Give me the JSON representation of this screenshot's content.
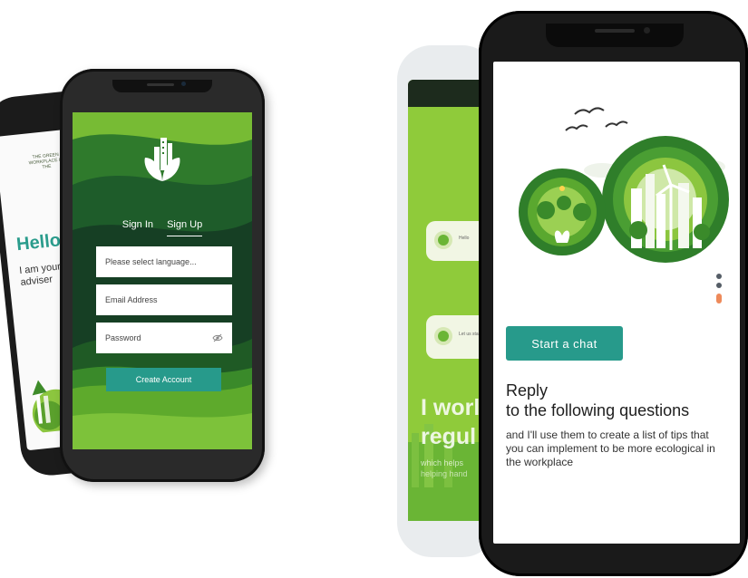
{
  "back_left": {
    "tiny_text": "THE GREEN WORKPLACE IN THE",
    "greeting": "Hello,",
    "intro_line1": "I am your N",
    "intro_line2": "adviser"
  },
  "signup_screen": {
    "tabs": [
      {
        "label": "Sign In",
        "active": false
      },
      {
        "label": "Sign Up",
        "active": true
      }
    ],
    "language_placeholder": "Please select language...",
    "email_placeholder": "Email Address",
    "password_placeholder": "Password",
    "create_button": "Create Account"
  },
  "back_right": {
    "bubble1_text": "Hello",
    "bubble2_text": "Let us start",
    "big_line1": "I worl",
    "big_line2": "regul",
    "small_line": "which helps",
    "small_line2": "helping hand"
  },
  "chat_screen": {
    "start_button": "Start a chat",
    "reply_heading": "Reply",
    "reply_subheading": "to the following questions",
    "description": "and I'll use them to create a list of tips that you can implement to be more ecological in the workplace",
    "page_dots": [
      "inactive",
      "inactive",
      "active"
    ]
  },
  "colors": {
    "accent_teal": "#279a8b",
    "leaf_green": "#6ab535",
    "dark_green": "#1e4d2b",
    "dot_active": "#ee8a5a"
  }
}
